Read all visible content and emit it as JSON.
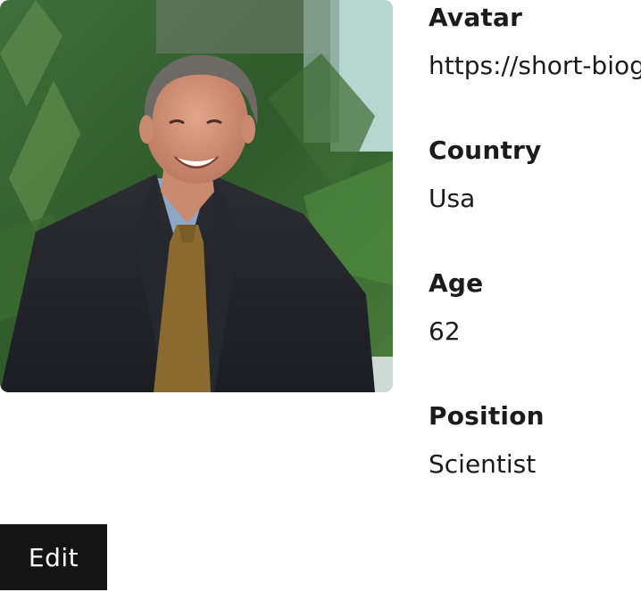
{
  "profile": {
    "fields": [
      {
        "label": "Avatar",
        "value": "https://short-biog"
      },
      {
        "label": "Country",
        "value": "Usa"
      },
      {
        "label": "Age",
        "value": "62"
      },
      {
        "label": "Position",
        "value": "Scientist"
      }
    ]
  },
  "actions": {
    "edit_label": "Edit"
  }
}
